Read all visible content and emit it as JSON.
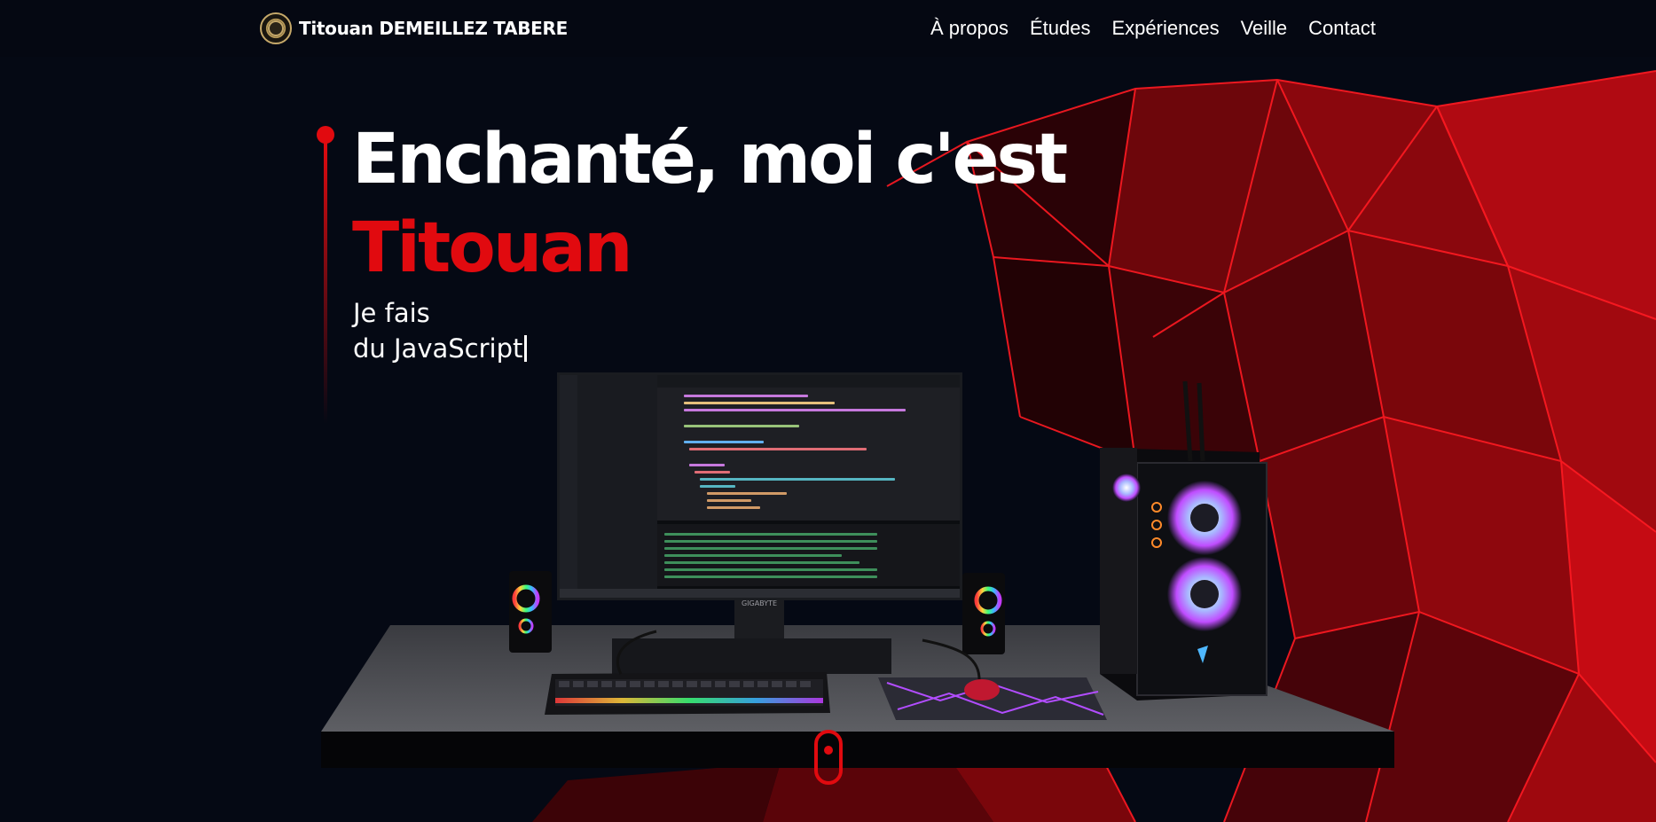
{
  "brand": {
    "name": "Titouan DEMEILLEZ TABERE",
    "logo_icon": "monogram-logo-icon"
  },
  "nav": {
    "items": [
      "À propos",
      "Études",
      "Expériences",
      "Veille",
      "Contact"
    ]
  },
  "hero": {
    "title_line1": "Enchanté, moi c'est",
    "title_name": "Titouan",
    "subtitle_line1": "Je fais",
    "subtitle_line2": "du JavaScript"
  },
  "colors": {
    "accent": "#e10a0f",
    "background": "#050914",
    "text": "#ffffff"
  },
  "monitor_brand": "GIGABYTE",
  "scroll_indicator_icon": "mouse-scroll-icon"
}
